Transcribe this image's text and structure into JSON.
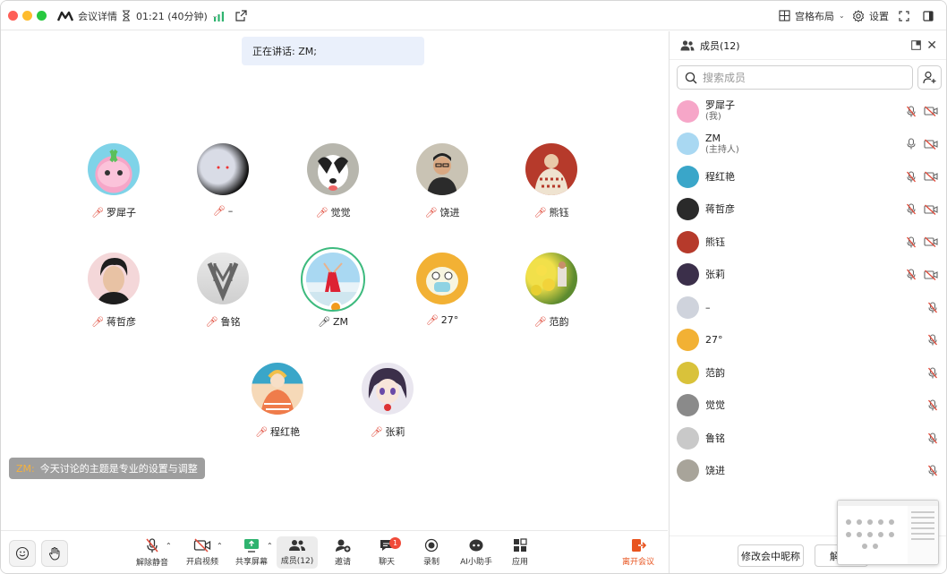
{
  "titlebar": {
    "app_title": "会议详情",
    "timer": "01:21 (40分钟)",
    "layout_label": "宫格布局",
    "settings_label": "设置"
  },
  "main": {
    "speaking_text": "正在讲话: ZM;",
    "tiles": [
      {
        "name": "罗犀子"
      },
      {
        "name": "–"
      },
      {
        "name": "觉觉"
      },
      {
        "name": "饶进"
      },
      {
        "name": "熊钰"
      },
      {
        "name": "蒋哲彦"
      },
      {
        "name": "鲁铭"
      },
      {
        "name": "ZM"
      },
      {
        "name": "27°"
      },
      {
        "name": "范韵"
      },
      {
        "name": "程红艳"
      },
      {
        "name": "张莉"
      }
    ],
    "subtitle": {
      "speaker": "ZM:",
      "text": "今天讨论的主题是专业的设置与调整"
    }
  },
  "bottombar": {
    "unmute": "解除静音",
    "video": "开启视频",
    "share": "共享屏幕",
    "members": "成员(12)",
    "invite": "邀请",
    "chat": "聊天",
    "chat_badge": "1",
    "record": "录制",
    "ai": "AI小助手",
    "apps": "应用",
    "leave": "离开会议"
  },
  "sidebar": {
    "title": "成员(12)",
    "search_placeholder": "搜索成员",
    "members": [
      {
        "name": "罗犀子",
        "tag": "(我)"
      },
      {
        "name": "ZM",
        "tag": "(主持人)"
      },
      {
        "name": "程红艳",
        "tag": ""
      },
      {
        "name": "蒋哲彦",
        "tag": ""
      },
      {
        "name": "熊钰",
        "tag": ""
      },
      {
        "name": "张莉",
        "tag": ""
      },
      {
        "name": "–",
        "tag": ""
      },
      {
        "name": "27°",
        "tag": ""
      },
      {
        "name": "范韵",
        "tag": ""
      },
      {
        "name": "觉觉",
        "tag": ""
      },
      {
        "name": "鲁铭",
        "tag": ""
      },
      {
        "name": "饶进",
        "tag": ""
      }
    ],
    "rename_button": "修改会中昵称",
    "partial_button": "解"
  },
  "colors": {
    "host_ring": "#3dba7e",
    "leave": "#e8541f",
    "mute_red": "#e04a3a",
    "signal": "#2fb36f",
    "badge": "#f04b3a"
  }
}
